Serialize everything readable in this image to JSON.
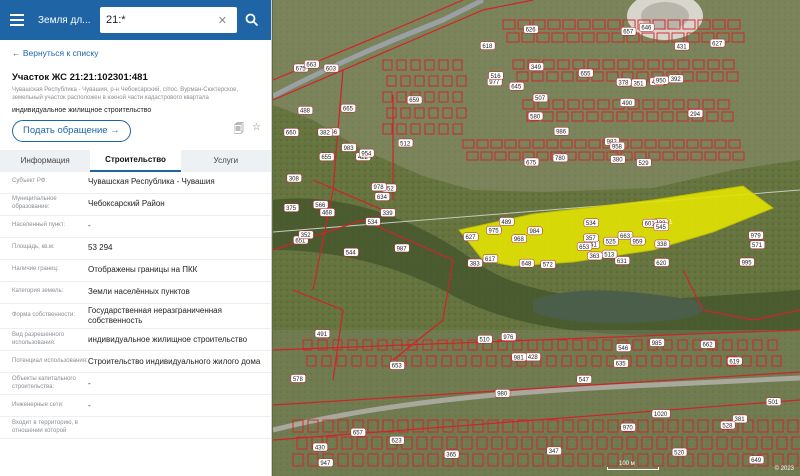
{
  "search": {
    "layer_label": "Земля дл...",
    "query": "21:*"
  },
  "panel": {
    "back_label": "← Вернуться к списку",
    "title": "Участок ЖС 21:21:102301:481",
    "address": "Чувашская Республика - Чувашия, р-н Чебоксарский, с/пос. Вурман-Сюктерское, земельный участок расположен в южной части кадастрового квартала",
    "purpose": "индивидуальное жилищное строительство",
    "submit_label": "Подать обращение →"
  },
  "tabs": [
    {
      "label": "Информация"
    },
    {
      "label": "Строительство"
    },
    {
      "label": "Услуги"
    }
  ],
  "rows": [
    {
      "key": "Субъект РФ:",
      "value": "Чувашская Республика - Чувашия"
    },
    {
      "key": "Муниципальное образование:",
      "value": "Чебоксарский Район"
    },
    {
      "key": "Населенный пункт:",
      "value": "-"
    },
    {
      "key": "Площадь, кв.м:",
      "value": "53 294"
    },
    {
      "key": "Наличие границ:",
      "value": "Отображены границы на ПКК"
    },
    {
      "key": "Категория земель:",
      "value": "Земли населённых пунктов"
    },
    {
      "key": "Форма собственности:",
      "value": "Государственная неразграниченная собственность"
    },
    {
      "key": "Вид разрешенного использования:",
      "value": "индивидуальное жилищное строительство"
    },
    {
      "key": "Потенциал использования:",
      "value": "Строительство индивидуального жилого дома"
    },
    {
      "key": "Объекты капитального строительства:",
      "value": "-"
    },
    {
      "key": "Инженерные сети:",
      "value": "-"
    },
    {
      "key": "Входит в территорию, в отношении которой",
      "value": ""
    }
  ],
  "map": {
    "parcel_label": "481",
    "scale_label": "100 м",
    "copyright": "© 2023",
    "lot_numbers": [
      "490",
      "488",
      "461",
      "430",
      "436",
      "468",
      "432",
      "428",
      "431",
      "422",
      "489",
      "649",
      "645",
      "659",
      "653",
      "635",
      "675",
      "665",
      "663",
      "657",
      "655",
      "651",
      "648",
      "981",
      "950",
      "952",
      "975",
      "976",
      "977",
      "978",
      "979",
      "980",
      "982",
      "983",
      "984",
      "985",
      "986",
      "987",
      "995",
      "1020",
      "646",
      "966",
      "968",
      "970",
      "780",
      "660",
      "959",
      "947",
      "958",
      "954",
      "617",
      "619",
      "618",
      "634",
      "620",
      "623",
      "626",
      "675",
      "631",
      "662",
      "657",
      "655",
      "627",
      "653",
      "627",
      "663",
      "601",
      "510",
      "378",
      "375",
      "363",
      "365",
      "294",
      "382",
      "383",
      "491",
      "349",
      "308",
      "357",
      "347",
      "351",
      "352",
      "338",
      "381",
      "380",
      "512",
      "513",
      "520",
      "529",
      "534",
      "534",
      "501",
      "392",
      "339",
      "525",
      "528",
      "516",
      "544",
      "545",
      "546",
      "507",
      "603",
      "571",
      "578",
      "580",
      "566",
      "572",
      "547"
    ]
  }
}
